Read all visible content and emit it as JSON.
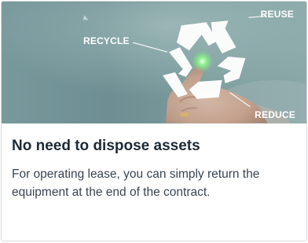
{
  "card": {
    "image": {
      "labels": {
        "recycle": "RECYCLE",
        "reuse": "REUSE",
        "reduce": "REDUCE"
      },
      "icon": "recycle-icon",
      "colors": {
        "background": "#6f9194",
        "symbol": "#ffffff",
        "glow": "#7be37b"
      }
    },
    "title": "No need to dispose assets",
    "description": "For operating lease, you can simply return the equipment at the end of the contract."
  }
}
